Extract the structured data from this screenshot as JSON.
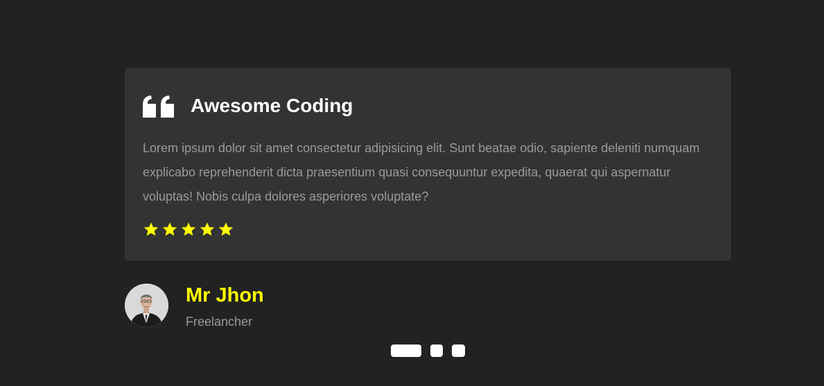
{
  "testimonial": {
    "title": "Awesome Coding",
    "text": "Lorem ipsum dolor sit amet consectetur adipisicing elit. Sunt beatae odio, sapiente deleniti numquam explicabo reprehenderit dicta praesentium quasi consequuntur expedita, quaerat qui aspernatur voluptas! Nobis culpa dolores asperiores voluptate?",
    "rating": 5,
    "rating_max": 5,
    "quote_icon": "quote-icon",
    "star_icon": "star-icon"
  },
  "author": {
    "name": "Mr Jhon",
    "role": "Freelancher"
  },
  "pagination": {
    "total": 3,
    "active_index": 0
  },
  "colors": {
    "background": "#222222",
    "card": "#333333",
    "accent": "#ffff00",
    "title": "#ffffff",
    "body_text": "#9a9a9a"
  }
}
